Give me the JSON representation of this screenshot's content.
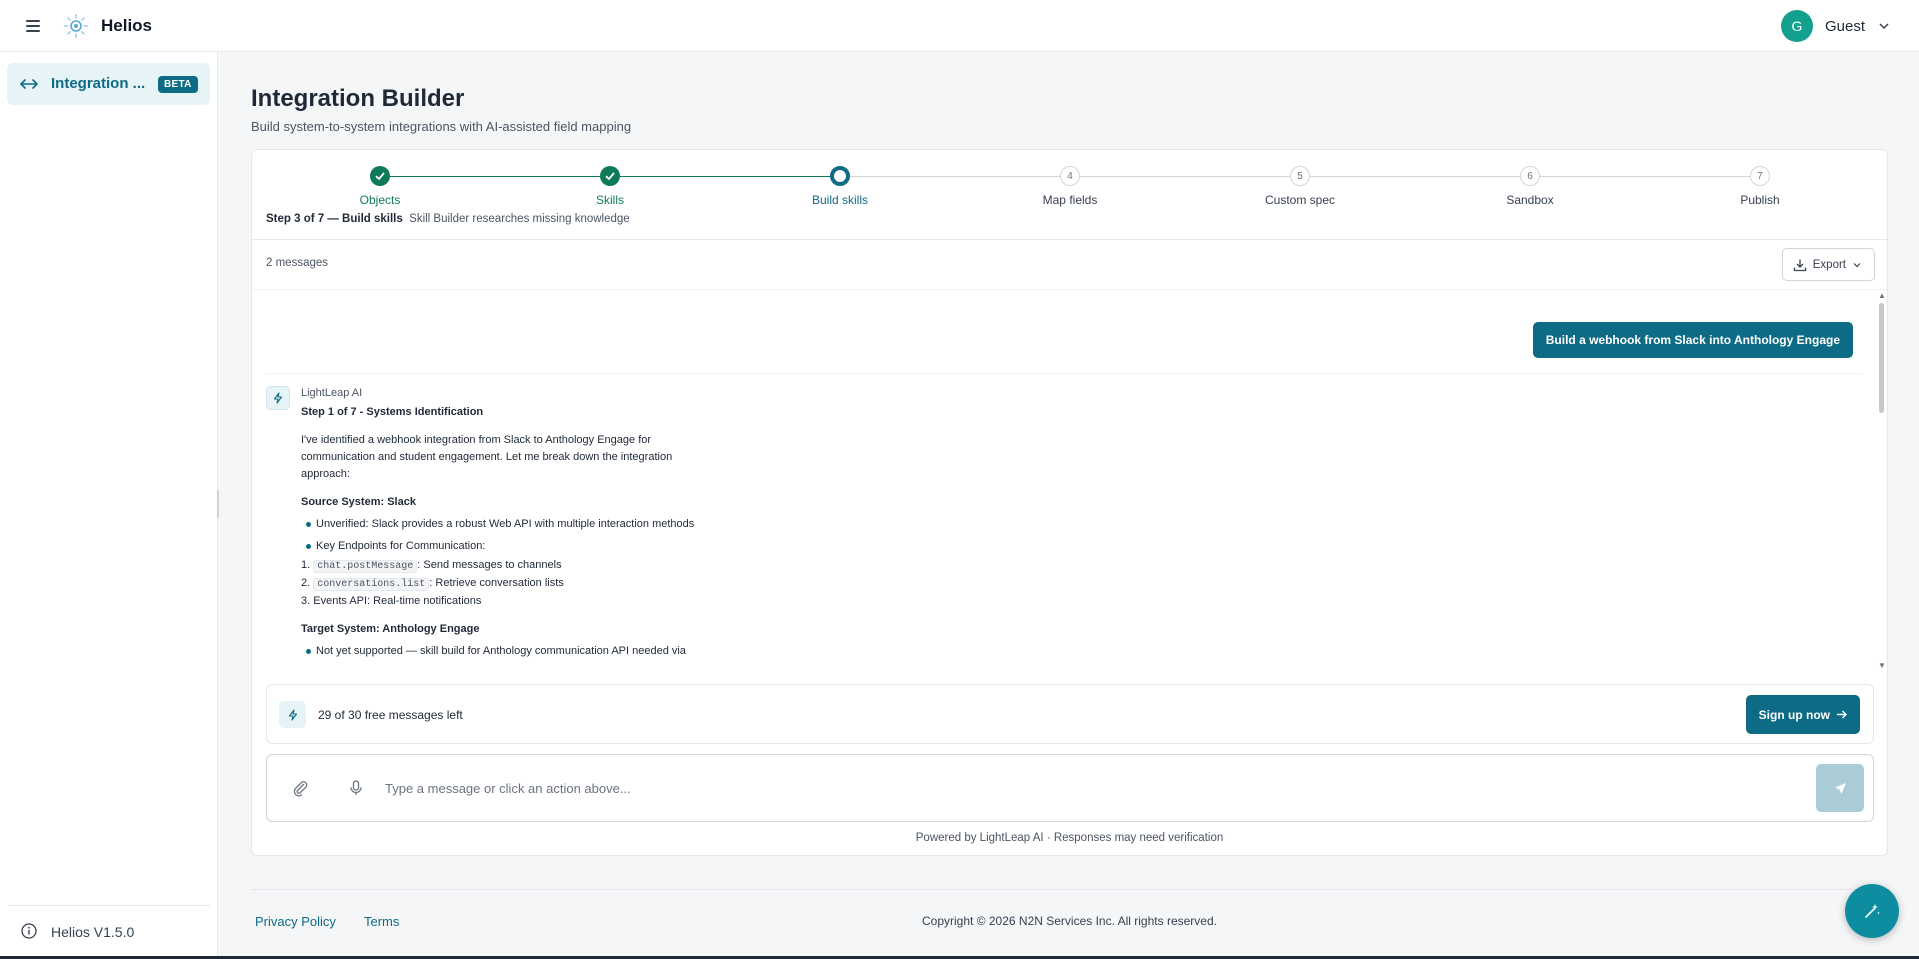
{
  "app": {
    "brand": "Helios",
    "user_initial": "G",
    "user_name": "Guest"
  },
  "sidebar": {
    "items": [
      {
        "label": "Integration ...",
        "badge": "BETA"
      }
    ],
    "version": "Helios V1.5.0"
  },
  "page": {
    "title": "Integration Builder",
    "subtitle": "Build system-to-system integrations with AI-assisted field mapping"
  },
  "stepper": {
    "steps": [
      {
        "label": "Objects",
        "state": "done",
        "number": "1"
      },
      {
        "label": "Skills",
        "state": "done",
        "number": "2"
      },
      {
        "label": "Build skills",
        "state": "current",
        "number": "3"
      },
      {
        "label": "Map fields",
        "state": "pending",
        "number": "4"
      },
      {
        "label": "Custom spec",
        "state": "pending",
        "number": "5"
      },
      {
        "label": "Sandbox",
        "state": "pending",
        "number": "6"
      },
      {
        "label": "Publish",
        "state": "pending",
        "number": "7"
      }
    ],
    "info_bold": "Step 3 of 7 — Build skills",
    "info_text": "Skill Builder researches missing knowledge"
  },
  "chat": {
    "message_count": "2 messages",
    "export_label": "Export",
    "user_message": "Build a webhook from Slack into Anthology Engage",
    "ai_name": "LightLeap AI",
    "ai_heading": "Step 1 of 7 - Systems Identification",
    "ai_intro": "I've identified a webhook integration from Slack to Anthology Engage for communication and student engagement. Let me break down the integration approach:",
    "source_heading": "Source System: Slack",
    "source_bullets": [
      "Unverified: Slack provides a robust Web API with multiple interaction methods",
      "Key Endpoints for Communication:"
    ],
    "endpoints": [
      {
        "num": "1.",
        "code": "chat.postMessage",
        "text": ": Send messages to channels"
      },
      {
        "num": "2.",
        "code": "conversations.list",
        "text": ": Retrieve conversation lists"
      },
      {
        "num": "3.",
        "code": "",
        "text": "Events API: Real-time notifications"
      }
    ],
    "target_heading": "Target System: Anthology Engage",
    "target_partial": "Not yet supported — skill build for Anthology communication API needed via"
  },
  "quota": {
    "text": "29 of 30 free messages left",
    "signup_label": "Sign up now"
  },
  "composer": {
    "placeholder": "Type a message or click an action above..."
  },
  "powered_by": "Powered by LightLeap AI · Responses may need verification",
  "footer": {
    "privacy": "Privacy Policy",
    "terms": "Terms",
    "copyright": "Copyright © 2026 N2N Services Inc. All rights reserved."
  },
  "colors": {
    "accent": "#0e6b86",
    "done": "#0f7a5a",
    "fab": "#0f8da0",
    "avatar": "#14a08f"
  }
}
